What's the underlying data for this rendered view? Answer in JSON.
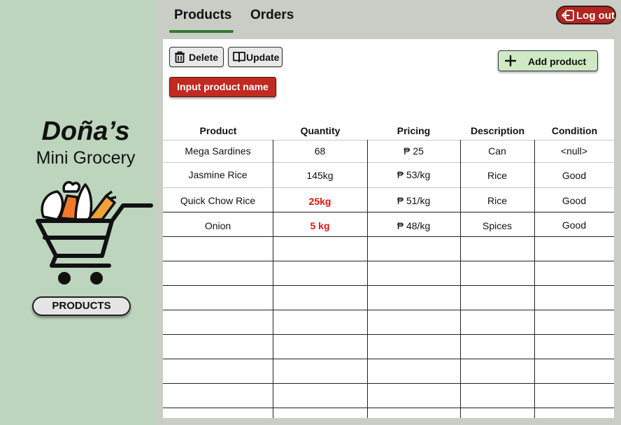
{
  "brand": {
    "title": "Doña’s",
    "subtitle": "Mini Grocery"
  },
  "sidebar": {
    "products_button": "PRODUCTS"
  },
  "nav": {
    "tabs": [
      {
        "label": "Products",
        "active": true
      },
      {
        "label": "Orders",
        "active": false
      }
    ]
  },
  "header": {
    "logout_label": "Log out"
  },
  "toolbar": {
    "delete_label": "Delete",
    "update_label": "Update",
    "add_label": "Add product",
    "input_label": "Input product name"
  },
  "table": {
    "columns": [
      "Product",
      "Quantity",
      "Pricing",
      "Description",
      "Condition"
    ],
    "rows": [
      {
        "product": "Mega Sardines",
        "quantity": "68",
        "pricing": "₱ 25",
        "description": "Can",
        "condition": "<null>",
        "low_stock": false
      },
      {
        "product": "Jasmine Rice",
        "quantity": "145kg",
        "pricing": "₱ 53/kg",
        "description": "Rice",
        "condition": "Good",
        "low_stock": false
      },
      {
        "product": "Quick Chow Rice",
        "quantity": "25kg",
        "pricing": "₱ 51/kg",
        "description": "Rice",
        "condition": "Good",
        "low_stock": true
      },
      {
        "product": "Onion",
        "quantity": "5 kg",
        "pricing": "₱ 48/kg",
        "description": "Spices",
        "condition": "Good",
        "low_stock": true
      }
    ]
  },
  "colors": {
    "sidebar_bg": "#bdd4bd",
    "accent_green": "#2f7d32",
    "danger_red": "#c02a20",
    "low_stock_red": "#e01414",
    "add_button_bg": "#cfe9c4"
  },
  "icons": {
    "cart": "grocery-cart-icon",
    "logout": "logout-icon",
    "delete": "trash-icon",
    "update": "book-icon",
    "add": "plus-icon"
  }
}
